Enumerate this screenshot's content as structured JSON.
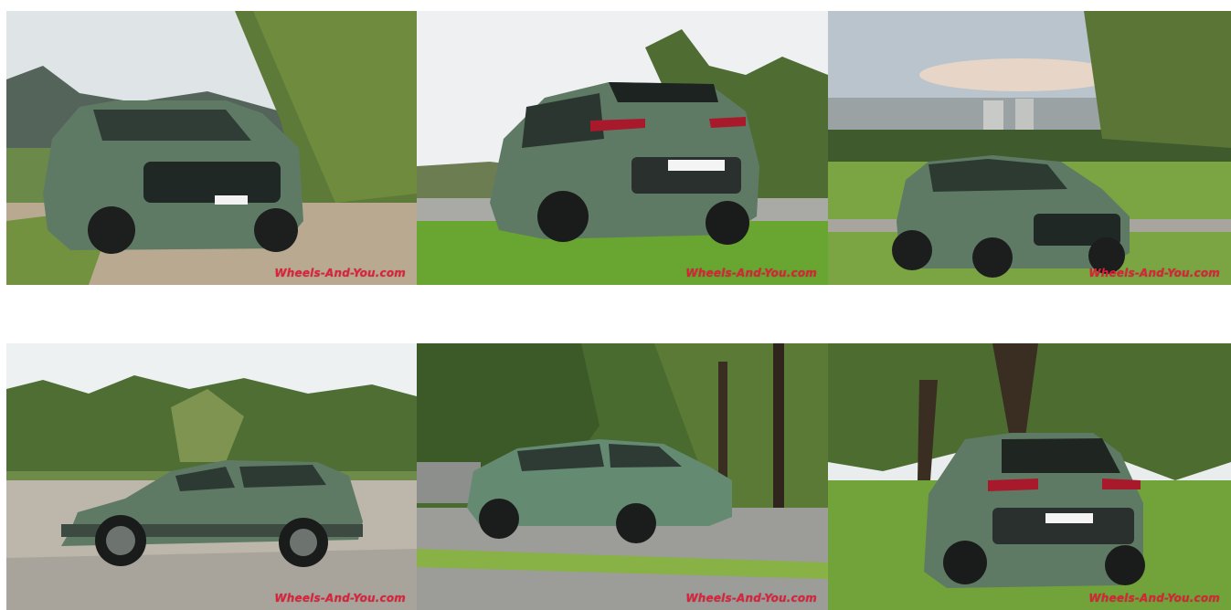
{
  "photos": [
    {
      "watermark": "Wheels-And-You.com"
    },
    {
      "watermark": "Wheels-And-You.com"
    },
    {
      "watermark": "Wheels-And-You.com"
    },
    {
      "watermark": "Wheels-And-You.com"
    },
    {
      "watermark": "Wheels-And-You.com"
    },
    {
      "watermark": "Wheels-And-You.com"
    }
  ],
  "colors": {
    "car_body": "#5f7a64",
    "car_dark": "#2c3a31",
    "grass": "#6ea33c",
    "tree": "#4b6e34",
    "sky": "#e8ecee",
    "watermark": "#e0203a"
  }
}
